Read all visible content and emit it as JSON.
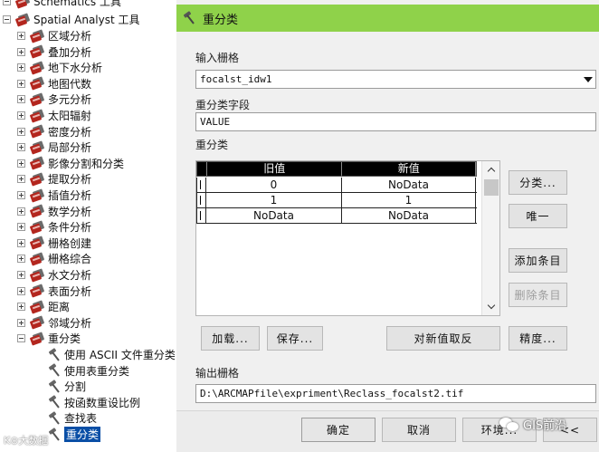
{
  "tree": {
    "top_partial": "Schematics 工具",
    "root_label": "Spatial Analyst 工具",
    "toolsets": [
      "区域分析",
      "叠加分析",
      "地下水分析",
      "地图代数",
      "多元分析",
      "太阳辐射",
      "密度分析",
      "局部分析",
      "影像分割和分类",
      "提取分析",
      "插值分析",
      "数学分析",
      "条件分析",
      "栅格创建",
      "栅格综合",
      "水文分析",
      "表面分析",
      "距离",
      "邻域分析",
      "重分类"
    ],
    "reclass_tools": [
      "使用 ASCII 文件重分类",
      "使用表重分类",
      "分割",
      "按函数重设比例",
      "查找表",
      "重分类"
    ],
    "selected_tool": "重分类"
  },
  "dialog": {
    "title": "重分类",
    "input_raster_label": "输入栅格",
    "input_raster_value": "focalst_idw1",
    "reclass_field_label": "重分类字段",
    "reclass_field_value": "VALUE",
    "reclassification_label": "重分类",
    "table": {
      "headers": [
        "旧值",
        "新值"
      ],
      "rows": [
        {
          "old": "0",
          "new": "NoData"
        },
        {
          "old": "1",
          "new": "1"
        },
        {
          "old": "NoData",
          "new": "NoData"
        }
      ]
    },
    "side_buttons": {
      "classify": "分类...",
      "unique": "唯一",
      "add_entry": "添加条目",
      "delete_entries": "删除条目"
    },
    "bottom_table_buttons": {
      "load": "加载...",
      "save": "保存...",
      "reverse": "对新值取反",
      "precision": "精度..."
    },
    "output_raster_label": "输出栅格",
    "output_raster_value": "D:\\ARCMAPfile\\expriment\\Reclass_focalst2.tif",
    "footer_buttons": {
      "ok": "确定",
      "cancel": "取消",
      "environments": "环境...",
      "show_help": "<<"
    }
  },
  "watermarks": {
    "left": "K⊙大数据",
    "right": "GIS前沿"
  },
  "colors": {
    "titlebar": "#8fd24a",
    "selection": "#0a4fa6",
    "toolbox_red": "#b3261e"
  }
}
